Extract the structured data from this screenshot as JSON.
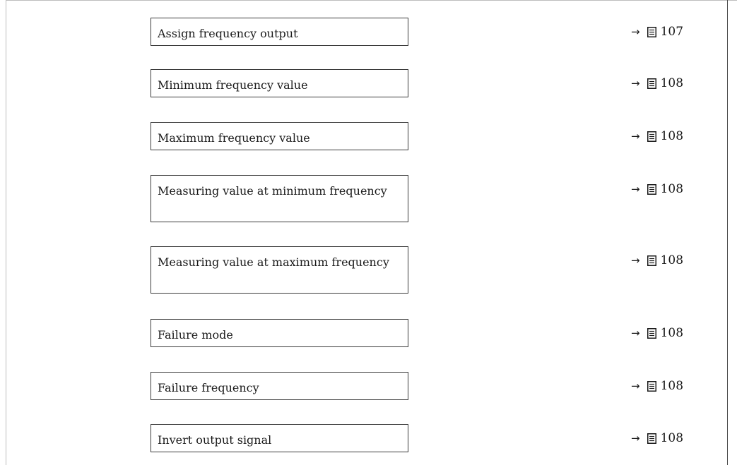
{
  "parameters": [
    {
      "label": "Assign frequency output",
      "ref_arrow": "→",
      "ref_page": "107"
    },
    {
      "label": "Minimum frequency value",
      "ref_arrow": "→",
      "ref_page": "108"
    },
    {
      "label": "Maximum frequency value",
      "ref_arrow": "→",
      "ref_page": "108"
    },
    {
      "label": "Measuring value at minimum frequency",
      "ref_arrow": "→",
      "ref_page": "108"
    },
    {
      "label": "Measuring value at maximum frequency",
      "ref_arrow": "→",
      "ref_page": "108"
    },
    {
      "label": "Failure mode",
      "ref_arrow": "→",
      "ref_page": "108"
    },
    {
      "label": "Failure frequency",
      "ref_arrow": "→",
      "ref_page": "108"
    },
    {
      "label": "Invert output signal",
      "ref_arrow": "→",
      "ref_page": "108"
    }
  ],
  "icons": {
    "page_reference": "page-reference-icon"
  }
}
